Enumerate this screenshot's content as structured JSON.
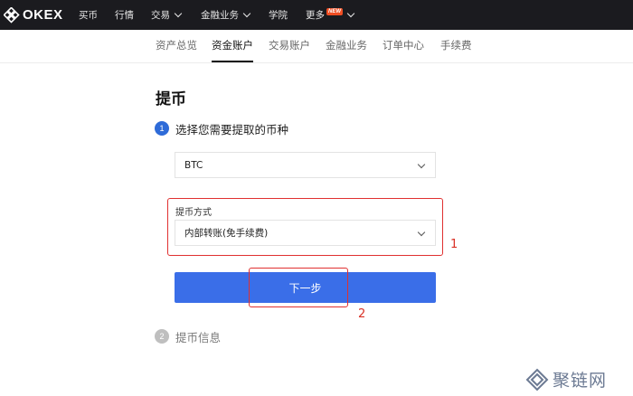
{
  "brand": {
    "name": "OKEX"
  },
  "topnav": {
    "items": [
      {
        "label": "买币"
      },
      {
        "label": "行情"
      },
      {
        "label": "交易"
      },
      {
        "label": "金融业务"
      },
      {
        "label": "学院"
      },
      {
        "label": "更多"
      }
    ],
    "new_badge": "NEW"
  },
  "subnav": {
    "items": [
      {
        "label": "资产总览"
      },
      {
        "label": "资金账户"
      },
      {
        "label": "交易账户"
      },
      {
        "label": "金融业务"
      },
      {
        "label": "订单中心"
      },
      {
        "label": "手续费"
      }
    ],
    "active": "资金账户"
  },
  "page": {
    "title": "提币",
    "step1": {
      "number": "1",
      "label": "选择您需要提取的币种"
    },
    "step2": {
      "number": "2",
      "label": "提币信息"
    },
    "coin_select": {
      "value": "BTC"
    },
    "method": {
      "label": "提币方式",
      "value": "内部转账(免手续费)"
    },
    "next_button": "下一步"
  },
  "annotations": {
    "box1": "1",
    "box2": "2"
  },
  "watermark": {
    "text": "聚链网"
  },
  "colors": {
    "nav_bg": "#1b1b1f",
    "primary": "#3a6ee8",
    "step_active": "#2e6bd8",
    "annotation": "#e03030",
    "badge": "#f04e23"
  }
}
